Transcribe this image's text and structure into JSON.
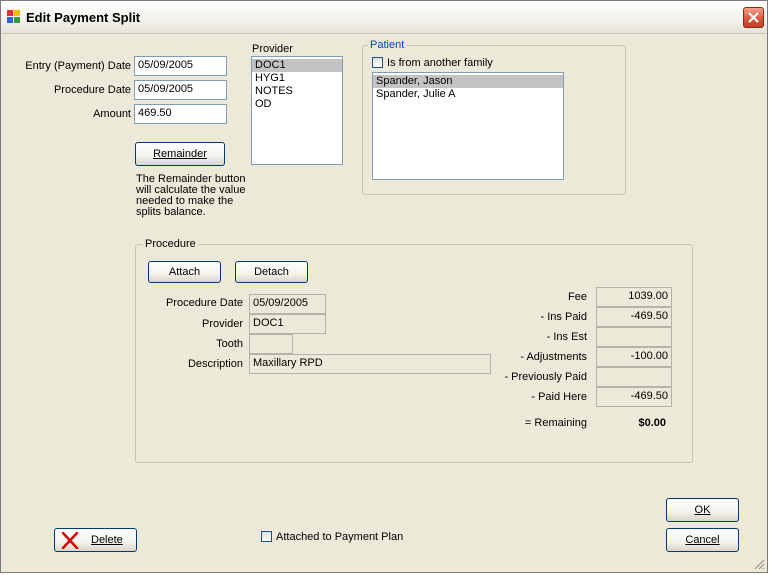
{
  "window": {
    "title": "Edit Payment Split",
    "close_label": "close"
  },
  "entry": {
    "entry_date_label": "Entry (Payment) Date",
    "entry_date_value": "05/09/2005",
    "proc_date_label": "Procedure Date",
    "proc_date_value": "05/09/2005",
    "amount_label": "Amount",
    "amount_value": "469.50"
  },
  "remainder": {
    "button_label": "Remainder",
    "help_lines": [
      "The Remainder button",
      "will calculate the value",
      "needed to make the",
      "splits balance."
    ]
  },
  "provider": {
    "label": "Provider",
    "items": [
      "DOC1",
      "HYG1",
      "NOTES",
      "OD"
    ],
    "selected": "DOC1"
  },
  "patient": {
    "group_label": "Patient",
    "checkbox_label": "Is from another family",
    "items": [
      "Spander, Jason",
      "Spander, Julie A"
    ],
    "selected": "Spander, Jason"
  },
  "procedure": {
    "group_label": "Procedure",
    "attach_label": "Attach",
    "detach_label": "Detach",
    "fields": {
      "proc_date_label": "Procedure Date",
      "proc_date_value": "05/09/2005",
      "provider_label": "Provider",
      "provider_value": "DOC1",
      "tooth_label": "Tooth",
      "tooth_value": "",
      "description_label": "Description",
      "description_value": "Maxillary RPD"
    },
    "amounts": {
      "fee_label": "Fee",
      "fee_value": "1039.00",
      "ins_paid_label": "- Ins Paid",
      "ins_paid_value": "-469.50",
      "ins_est_label": "- Ins Est",
      "ins_est_value": "",
      "adjustments_label": "- Adjustments",
      "adjustments_value": "-100.00",
      "prev_paid_label": "- Previously Paid",
      "prev_paid_value": "",
      "paid_here_label": "- Paid Here",
      "paid_here_value": "-469.50",
      "remaining_label": "= Remaining",
      "remaining_value": "$0.00"
    }
  },
  "footer": {
    "delete_label": "Delete",
    "payment_plan_label": "Attached to Payment Plan",
    "ok_label": "OK",
    "cancel_label": "Cancel"
  },
  "colors": {
    "close_button": "#d8593c",
    "group_title_blue": "#0046d5",
    "selection": "#c3c3c3",
    "delete_x": "#d40000"
  }
}
